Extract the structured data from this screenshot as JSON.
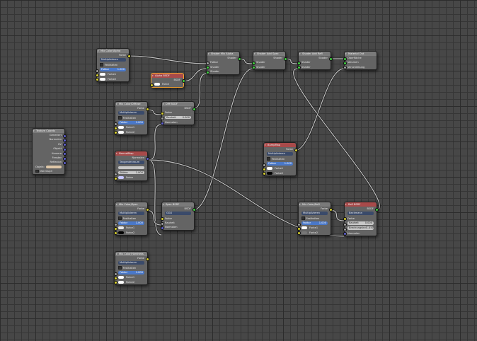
{
  "editor": {
    "title": "Node Editor"
  },
  "colors": {
    "socket_color": "#d8d030",
    "socket_shader": "#40d040",
    "socket_value": "#a0a0a0",
    "socket_vector": "#6060d0",
    "header_red": "#9c4848",
    "selected": "#f0a030"
  },
  "nodes": {
    "mix_alpha": {
      "title": "Mix Color/Alpha",
      "rows": [
        {
          "t": "out",
          "s": "yellow",
          "l": "Farbe"
        },
        {
          "t": "dd",
          "l": "Multiplizieren"
        },
        {
          "t": "chk",
          "l": "Festhalten"
        },
        {
          "t": "fld",
          "s": "gray",
          "l": "Faktor",
          "v": "1.000"
        },
        {
          "t": "sw",
          "s": "yellow",
          "l": "Farbe1",
          "c": "#ffffff"
        },
        {
          "t": "sw",
          "s": "yellow",
          "l": "Farbe2",
          "c": "#ffffff"
        }
      ]
    },
    "alpha_bsdf": {
      "title": "Alpha BSDF",
      "red": true,
      "sel": true,
      "rows": [
        {
          "t": "out",
          "s": "green",
          "l": "BSDF"
        },
        {
          "t": "sw",
          "s": "yellow",
          "l": "Farbe",
          "c": "#ffffff"
        }
      ]
    },
    "shader_mix_alpha": {
      "title": "Shader Mix Alpha",
      "rows": [
        {
          "t": "out",
          "s": "green",
          "l": "Shader"
        },
        {
          "t": "in",
          "s": "gray",
          "l": "Faktor"
        },
        {
          "t": "in",
          "s": "green",
          "l": "Shader"
        },
        {
          "t": "in",
          "s": "green",
          "l": "Shader"
        }
      ]
    },
    "shader_add_spec": {
      "title": "Shader Add Spec",
      "rows": [
        {
          "t": "out",
          "s": "green",
          "l": "Shader"
        },
        {
          "t": "in",
          "s": "green",
          "l": "Shader"
        },
        {
          "t": "in",
          "s": "green",
          "l": "Shader"
        }
      ]
    },
    "shader_add_refl": {
      "title": "Shader Add Refl",
      "rows": [
        {
          "t": "out",
          "s": "green",
          "l": "Shader"
        },
        {
          "t": "in",
          "s": "green",
          "l": "Shader"
        },
        {
          "t": "in",
          "s": "green",
          "l": "Shader"
        }
      ]
    },
    "material_out": {
      "title": "Material Out",
      "rows": [
        {
          "t": "in",
          "s": "green",
          "l": "Oberfläche"
        },
        {
          "t": "in",
          "s": "green",
          "l": "Volumen"
        },
        {
          "t": "in",
          "s": "gray",
          "l": "Verschiebung"
        }
      ]
    },
    "mix_diffuse": {
      "title": "Mix Color/Diffuse",
      "rows": [
        {
          "t": "out",
          "s": "yellow",
          "l": "Farbe"
        },
        {
          "t": "dd",
          "l": "Multiplizieren"
        },
        {
          "t": "chk",
          "l": "Festhalten"
        },
        {
          "t": "fld",
          "s": "gray",
          "l": "Faktor",
          "v": "1.000"
        },
        {
          "t": "sw",
          "s": "yellow",
          "l": "Farbe1",
          "c": "#ffffff"
        },
        {
          "t": "sw",
          "s": "yellow",
          "l": "Farbe2",
          "c": "#ffffff"
        }
      ]
    },
    "diff_bsdf": {
      "title": "Diff BSDF",
      "rows": [
        {
          "t": "out",
          "s": "green",
          "l": "BSDF"
        },
        {
          "t": "in",
          "s": "yellow",
          "l": "Farbe"
        },
        {
          "t": "fld",
          "gray": true,
          "s": "gray",
          "l": "Rauheit",
          "v": "0.000"
        },
        {
          "t": "in",
          "s": "blue",
          "l": "Normalen"
        }
      ]
    },
    "texture_coords": {
      "title": "Texture Coords",
      "rows": [
        {
          "t": "out",
          "s": "blue",
          "l": "Generiert"
        },
        {
          "t": "out",
          "s": "blue",
          "l": "Normalen"
        },
        {
          "t": "out",
          "s": "blue",
          "l": "UV"
        },
        {
          "t": "out",
          "s": "blue",
          "l": "Objekt"
        },
        {
          "t": "out",
          "s": "blue",
          "l": "Kamera"
        },
        {
          "t": "out",
          "s": "blue",
          "l": "Fenster"
        },
        {
          "t": "out",
          "s": "blue",
          "l": "Reflexion"
        },
        {
          "t": "obj",
          "l": "Objekt:"
        },
        {
          "t": "chk",
          "l": "Von Dupli"
        }
      ]
    },
    "normal_map": {
      "title": "NormalMap",
      "red": true,
      "rows": [
        {
          "t": "out",
          "s": "blue",
          "l": "Normalen"
        },
        {
          "t": "dd",
          "l": "Tangentenraum"
        },
        {
          "t": "fld",
          "gray": true,
          "l": "",
          "v": ""
        },
        {
          "t": "fld",
          "gray": true,
          "s": "gray",
          "l": "Stärke",
          "v": "1.000"
        },
        {
          "t": "sw",
          "s": "yellow",
          "l": "Farbe",
          "c": "#c8c8ff"
        }
      ]
    },
    "bump_map": {
      "title": "BumpMap",
      "red": true,
      "rows": [
        {
          "t": "out",
          "s": "yellow",
          "l": "Farbe"
        },
        {
          "t": "dd",
          "l": "Multiplizieren"
        },
        {
          "t": "chk",
          "l": "Festhalten"
        },
        {
          "t": "fld",
          "s": "gray",
          "l": "Faktor",
          "v": "1.000"
        },
        {
          "t": "sw",
          "s": "yellow",
          "l": "Farbe1",
          "c": "#ffffff"
        },
        {
          "t": "sw",
          "s": "yellow",
          "l": "Farbe2",
          "c": "#000000"
        }
      ]
    },
    "mix_spec": {
      "title": "Mix Color/Spec",
      "rows": [
        {
          "t": "out",
          "s": "yellow",
          "l": "Farbe"
        },
        {
          "t": "dd",
          "l": "Multiplizieren"
        },
        {
          "t": "chk",
          "l": "Festhalten"
        },
        {
          "t": "fld",
          "s": "gray",
          "l": "Faktor",
          "v": "1.000"
        },
        {
          "t": "sw",
          "s": "yellow",
          "l": "Farbe1",
          "c": "#e8e8e8"
        },
        {
          "t": "sw",
          "s": "yellow",
          "l": "Farbe2",
          "c": "#000000"
        }
      ]
    },
    "spec_bsdf": {
      "title": "Spec BSDF",
      "rows": [
        {
          "t": "out",
          "s": "green",
          "l": "BSDF"
        },
        {
          "t": "dd",
          "l": "GGX"
        },
        {
          "t": "in",
          "s": "yellow",
          "l": "Farbe"
        },
        {
          "t": "in",
          "s": "gray",
          "l": "Rauheit"
        },
        {
          "t": "in",
          "s": "blue",
          "l": "Normalen"
        }
      ]
    },
    "mix_refl": {
      "title": "Mix Color/Refl",
      "rows": [
        {
          "t": "out",
          "s": "yellow",
          "l": "Farbe"
        },
        {
          "t": "dd",
          "l": "Multiplizieren"
        },
        {
          "t": "chk",
          "l": "Festhalten"
        },
        {
          "t": "fld",
          "s": "gray",
          "l": "Faktor",
          "v": "1.000"
        },
        {
          "t": "sw",
          "s": "yellow",
          "l": "Farbe1",
          "c": "#ffffff"
        },
        {
          "t": "sw",
          "s": "yellow",
          "l": "Farbe2",
          "c": "#777777"
        }
      ]
    },
    "refl_bsdf": {
      "title": "Refl BSDF",
      "red": true,
      "rows": [
        {
          "t": "out",
          "s": "green",
          "l": "BSDF"
        },
        {
          "t": "dd",
          "l": "Beckmann"
        },
        {
          "t": "in",
          "s": "yellow",
          "l": "Farbe"
        },
        {
          "t": "fld",
          "gray": true,
          "s": "gray",
          "l": "Rauheit",
          "v": "0.000"
        },
        {
          "t": "fld",
          "gray": true,
          "s": "gray",
          "l": "Brechungsind",
          "v": "1.450"
        },
        {
          "t": "in",
          "s": "blue",
          "l": "Normalen"
        }
      ]
    },
    "mix_hardness": {
      "title": "Mix Color/Hardness",
      "rows": [
        {
          "t": "out",
          "s": "yellow",
          "l": "Farbe"
        },
        {
          "t": "dd",
          "l": "Multiplizieren"
        },
        {
          "t": "chk",
          "l": "Festhalten"
        },
        {
          "t": "fld",
          "s": "gray",
          "l": "Faktor",
          "v": "1.000"
        },
        {
          "t": "sw",
          "s": "yellow",
          "l": "Farbe1",
          "c": "#ffffff"
        },
        {
          "t": "sw",
          "s": "yellow",
          "l": "Farbe2",
          "c": "#ffffff"
        }
      ]
    }
  }
}
